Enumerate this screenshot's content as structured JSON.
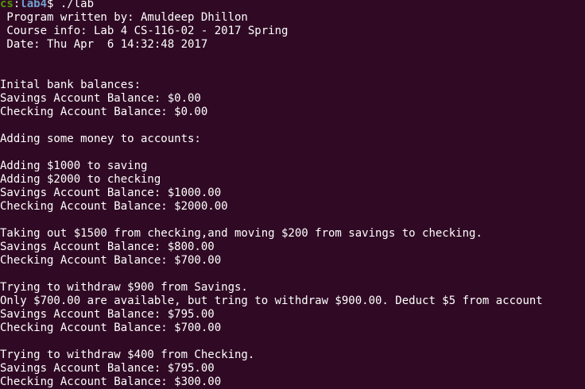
{
  "prompt": {
    "user": "cs",
    "separator": ":",
    "path": "lab4",
    "symbol": "$ ",
    "command": "./lab"
  },
  "lines": [
    " Program written by: Amuldeep Dhillon",
    " Course info: Lab 4 CS-116-02 - 2017 Spring",
    " Date: Thu Apr  6 14:32:48 2017",
    "",
    "",
    "Inital bank balances:",
    "Savings Account Balance: $0.00",
    "Checking Account Balance: $0.00",
    "",
    "Adding some money to accounts:",
    "",
    "Adding $1000 to saving",
    "Adding $2000 to checking",
    "Savings Account Balance: $1000.00",
    "Checking Account Balance: $2000.00",
    "",
    "Taking out $1500 from checking,and moving $200 from savings to checking.",
    "Savings Account Balance: $800.00",
    "Checking Account Balance: $700.00",
    "",
    "Trying to withdraw $900 from Savings.",
    "Only $700.00 are available, but tring to withdraw $900.00. Deduct $5 from account",
    "Savings Account Balance: $795.00",
    "Checking Account Balance: $700.00",
    "",
    "Trying to withdraw $400 from Checking.",
    "Savings Account Balance: $795.00",
    "Checking Account Balance: $300.00"
  ]
}
